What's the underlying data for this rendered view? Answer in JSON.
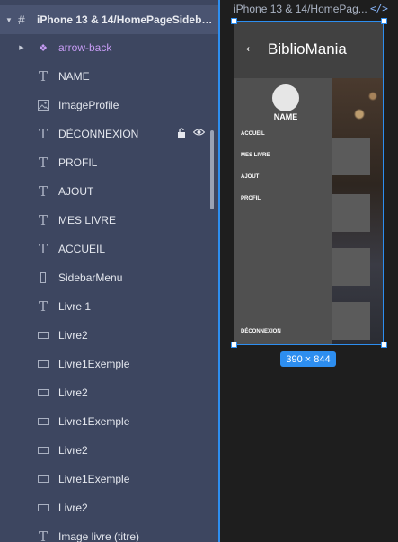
{
  "layers": {
    "frame_title": "iPhone 13 & 14/HomePageSidebar...",
    "children": [
      {
        "label": "arrow-back",
        "kind": "component",
        "icon": "component-icon"
      },
      {
        "label": "NAME",
        "kind": "text",
        "icon": "text-icon"
      },
      {
        "label": "ImageProfile",
        "kind": "image",
        "icon": "image-icon"
      },
      {
        "label": "DÉCONNEXION",
        "kind": "text",
        "icon": "text-icon",
        "hovered": true
      },
      {
        "label": "PROFIL",
        "kind": "text",
        "icon": "text-icon"
      },
      {
        "label": "AJOUT",
        "kind": "text",
        "icon": "text-icon"
      },
      {
        "label": "MES LIVRE",
        "kind": "text",
        "icon": "text-icon"
      },
      {
        "label": "ACCUEIL",
        "kind": "text",
        "icon": "text-icon"
      },
      {
        "label": "SidebarMenu",
        "kind": "rect-tall",
        "icon": "rectangle-icon"
      },
      {
        "label": "Livre 1",
        "kind": "text",
        "icon": "text-icon"
      },
      {
        "label": "Livre2",
        "kind": "rect",
        "icon": "rectangle-icon"
      },
      {
        "label": "Livre1Exemple",
        "kind": "rect",
        "icon": "rectangle-icon"
      },
      {
        "label": "Livre2",
        "kind": "rect",
        "icon": "rectangle-icon"
      },
      {
        "label": "Livre1Exemple",
        "kind": "rect",
        "icon": "rectangle-icon"
      },
      {
        "label": "Livre2",
        "kind": "rect",
        "icon": "rectangle-icon"
      },
      {
        "label": "Livre1Exemple",
        "kind": "rect",
        "icon": "rectangle-icon"
      },
      {
        "label": "Livre2",
        "kind": "rect",
        "icon": "rectangle-icon"
      },
      {
        "label": "Image livre (titre)",
        "kind": "text",
        "icon": "text-icon"
      }
    ]
  },
  "canvas": {
    "frame_label": "iPhone 13 & 14/HomePag...",
    "code_icon": "</>",
    "size_badge": "390 × 844"
  },
  "app": {
    "title": "BiblioMania",
    "back_icon": "←",
    "sidebar": {
      "name": "NAME",
      "menu": [
        "ACCUEIL",
        "MES LIVRE",
        "AJOUT",
        "PROFIL"
      ],
      "logout": "DÉCONNEXION"
    }
  },
  "colors": {
    "panel_bg": "#3d4660",
    "selection": "#2d8ef0",
    "component_text": "#c79cf5",
    "sidebar_bg": "#505050",
    "header_bg": "#414141"
  }
}
